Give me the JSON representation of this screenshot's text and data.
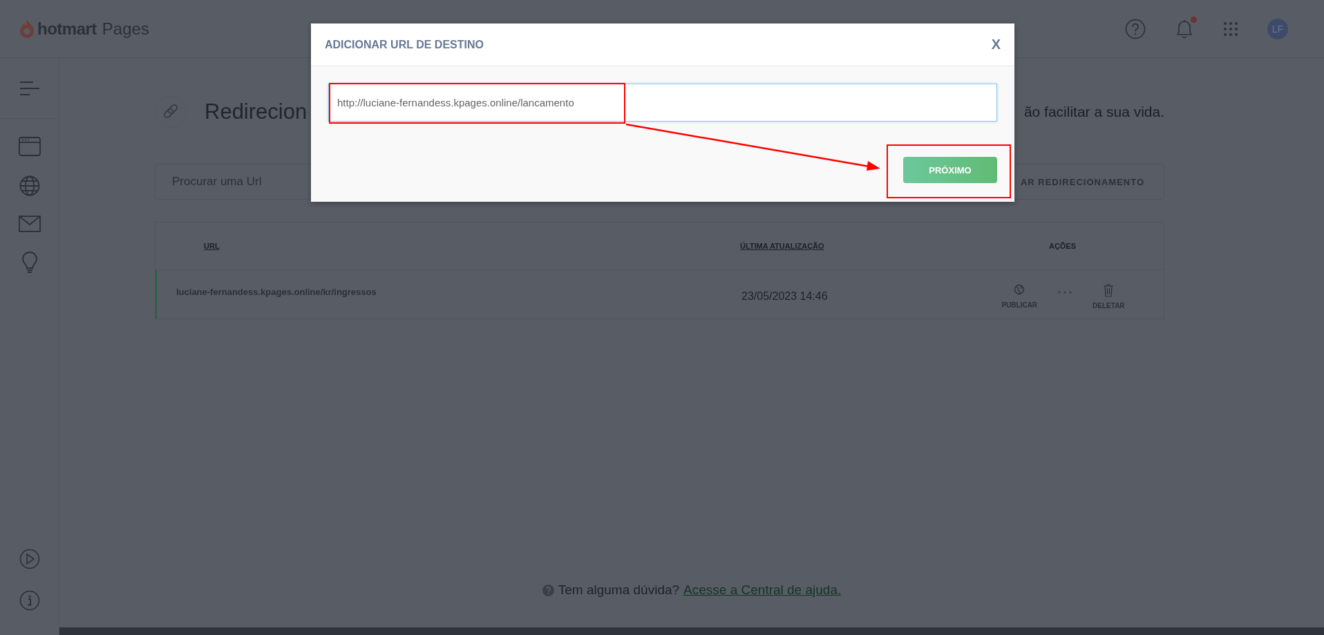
{
  "header": {
    "logo_word": "hotmart",
    "product": "Pages",
    "avatar": "LF",
    "has_notification": true
  },
  "page": {
    "title": "Redirecion",
    "subtitle_fragment": "ão facilitar a sua vida.",
    "search": {
      "placeholder": "Procurar uma Url"
    },
    "add_button": "AR REDIRECIONAMENTO"
  },
  "table": {
    "columns": [
      "URL",
      "ÚLTIMA ATUALIZAÇÃO",
      "AÇÕES"
    ],
    "rows": [
      {
        "url": "luciane-fernandess.kpages.online/kr/ingressos",
        "updated": "23/05/2023 14:46",
        "publish": "PUBLICAR",
        "delete": "DELETAR"
      }
    ]
  },
  "help": {
    "text": "Tem alguma dúvida?",
    "link": "Acesse a Central de ajuda."
  },
  "modal": {
    "title": "ADICIONAR URL DE DESTINO",
    "close": "X",
    "input_value": "http://luciane-fernandess.kpages.online/lancamento",
    "button": "PRÓXIMO"
  }
}
